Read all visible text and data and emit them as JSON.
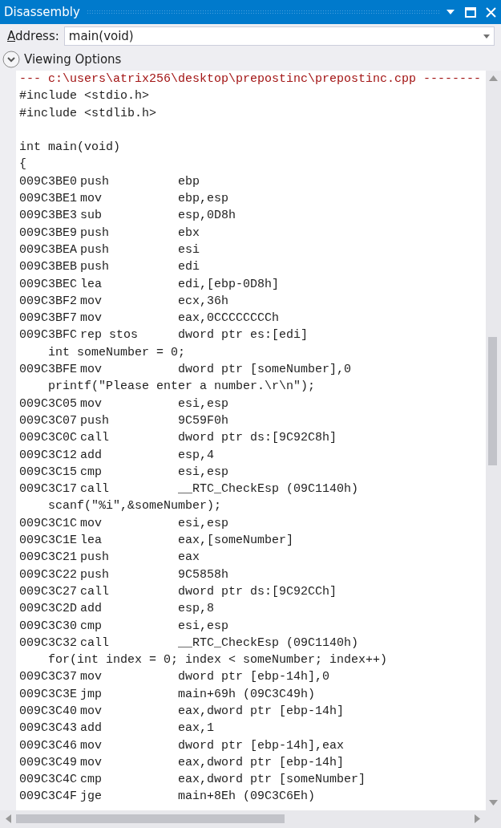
{
  "window": {
    "title": "Disassembly"
  },
  "address": {
    "label": "Address:",
    "value": "main(void)"
  },
  "viewing_options": {
    "label": "Viewing Options",
    "expanded": false
  },
  "lines": [
    {
      "kind": "header",
      "text": "--- c:\\users\\atrix256\\desktop\\prepostinc\\prepostinc.cpp --------"
    },
    {
      "kind": "source",
      "text": "#include <stdio.h>"
    },
    {
      "kind": "source",
      "text": "#include <stdlib.h>"
    },
    {
      "kind": "blank"
    },
    {
      "kind": "source",
      "text": "int main(void)"
    },
    {
      "kind": "source",
      "text": "{"
    },
    {
      "kind": "asm",
      "address": "009C3BE0",
      "mnemonic": "push",
      "operands": "ebp"
    },
    {
      "kind": "asm",
      "address": "009C3BE1",
      "mnemonic": "mov",
      "operands": "ebp,esp"
    },
    {
      "kind": "asm",
      "address": "009C3BE3",
      "mnemonic": "sub",
      "operands": "esp,0D8h"
    },
    {
      "kind": "asm",
      "address": "009C3BE9",
      "mnemonic": "push",
      "operands": "ebx"
    },
    {
      "kind": "asm",
      "address": "009C3BEA",
      "mnemonic": "push",
      "operands": "esi"
    },
    {
      "kind": "asm",
      "address": "009C3BEB",
      "mnemonic": "push",
      "operands": "edi"
    },
    {
      "kind": "asm",
      "address": "009C3BEC",
      "mnemonic": "lea",
      "operands": "edi,[ebp-0D8h]"
    },
    {
      "kind": "asm",
      "address": "009C3BF2",
      "mnemonic": "mov",
      "operands": "ecx,36h"
    },
    {
      "kind": "asm",
      "address": "009C3BF7",
      "mnemonic": "mov",
      "operands": "eax,0CCCCCCCCh"
    },
    {
      "kind": "asm",
      "address": "009C3BFC",
      "mnemonic": "rep stos",
      "operands": "dword ptr es:[edi]"
    },
    {
      "kind": "source",
      "text": "    int someNumber = 0;"
    },
    {
      "kind": "asm",
      "address": "009C3BFE",
      "mnemonic": "mov",
      "operands": "dword ptr [someNumber],0"
    },
    {
      "kind": "source",
      "text": "    printf(\"Please enter a number.\\r\\n\");"
    },
    {
      "kind": "asm",
      "address": "009C3C05",
      "mnemonic": "mov",
      "operands": "esi,esp"
    },
    {
      "kind": "asm",
      "address": "009C3C07",
      "mnemonic": "push",
      "operands": "9C59F0h"
    },
    {
      "kind": "asm",
      "address": "009C3C0C",
      "mnemonic": "call",
      "operands": "dword ptr ds:[9C92C8h]"
    },
    {
      "kind": "asm",
      "address": "009C3C12",
      "mnemonic": "add",
      "operands": "esp,4"
    },
    {
      "kind": "asm",
      "address": "009C3C15",
      "mnemonic": "cmp",
      "operands": "esi,esp"
    },
    {
      "kind": "asm",
      "address": "009C3C17",
      "mnemonic": "call",
      "operands": "__RTC_CheckEsp (09C1140h)"
    },
    {
      "kind": "source",
      "text": "    scanf(\"%i\",&someNumber);"
    },
    {
      "kind": "asm",
      "address": "009C3C1C",
      "mnemonic": "mov",
      "operands": "esi,esp"
    },
    {
      "kind": "asm",
      "address": "009C3C1E",
      "mnemonic": "lea",
      "operands": "eax,[someNumber]"
    },
    {
      "kind": "asm",
      "address": "009C3C21",
      "mnemonic": "push",
      "operands": "eax"
    },
    {
      "kind": "asm",
      "address": "009C3C22",
      "mnemonic": "push",
      "operands": "9C5858h"
    },
    {
      "kind": "asm",
      "address": "009C3C27",
      "mnemonic": "call",
      "operands": "dword ptr ds:[9C92CCh]"
    },
    {
      "kind": "asm",
      "address": "009C3C2D",
      "mnemonic": "add",
      "operands": "esp,8"
    },
    {
      "kind": "asm",
      "address": "009C3C30",
      "mnemonic": "cmp",
      "operands": "esi,esp"
    },
    {
      "kind": "asm",
      "address": "009C3C32",
      "mnemonic": "call",
      "operands": "__RTC_CheckEsp (09C1140h)"
    },
    {
      "kind": "source",
      "text": "    for(int index = 0; index < someNumber; index++)"
    },
    {
      "kind": "asm",
      "address": "009C3C37",
      "mnemonic": "mov",
      "operands": "dword ptr [ebp-14h],0"
    },
    {
      "kind": "asm",
      "address": "009C3C3E",
      "mnemonic": "jmp",
      "operands": "main+69h (09C3C49h)"
    },
    {
      "kind": "asm",
      "address": "009C3C40",
      "mnemonic": "mov",
      "operands": "eax,dword ptr [ebp-14h]"
    },
    {
      "kind": "asm",
      "address": "009C3C43",
      "mnemonic": "add",
      "operands": "eax,1"
    },
    {
      "kind": "asm",
      "address": "009C3C46",
      "mnemonic": "mov",
      "operands": "dword ptr [ebp-14h],eax"
    },
    {
      "kind": "asm",
      "address": "009C3C49",
      "mnemonic": "mov",
      "operands": "eax,dword ptr [ebp-14h]"
    },
    {
      "kind": "asm",
      "address": "009C3C4C",
      "mnemonic": "cmp",
      "operands": "eax,dword ptr [someNumber]"
    },
    {
      "kind": "asm",
      "address": "009C3C4F",
      "mnemonic": "jge",
      "operands": "main+8Eh (09C3C6Eh)"
    }
  ]
}
